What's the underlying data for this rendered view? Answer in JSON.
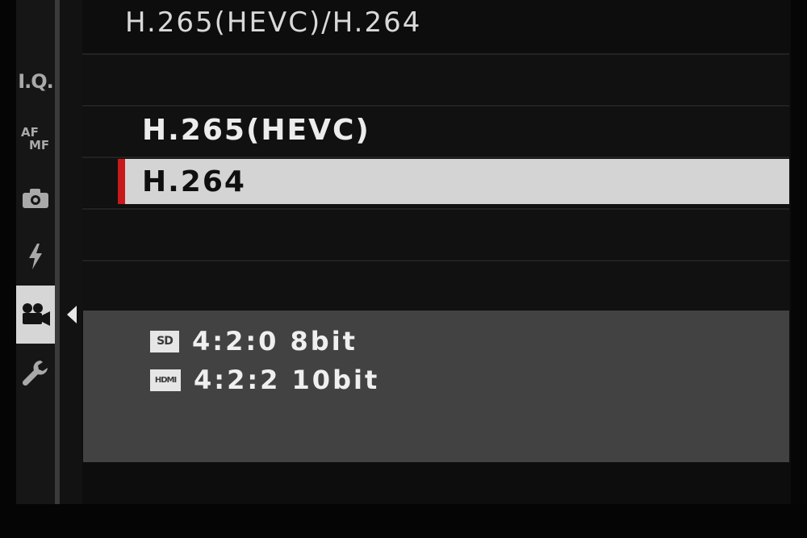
{
  "menu": {
    "title": "H.265(HEVC)/H.264",
    "options": [
      "H.265(HEVC)",
      "H.264"
    ],
    "selected_option": "H.264"
  },
  "sidebar": {
    "items": [
      {
        "icon": "iq-icon",
        "text": "I.Q."
      },
      {
        "icon": "af-mf-icon",
        "text_top": "AF",
        "text_bottom": "MF"
      },
      {
        "icon": "camera-icon"
      },
      {
        "icon": "flash-icon"
      },
      {
        "icon": "movie-camera-icon",
        "active": true
      },
      {
        "icon": "wrench-icon"
      }
    ]
  },
  "info": {
    "lines": [
      {
        "badge": "SD",
        "text": "4:2:0 8bit"
      },
      {
        "badge": "HDMI",
        "text": "4:2:2 10bit"
      }
    ]
  },
  "colors": {
    "selection_marker": "#c81a1a",
    "selected_row": "#d4d4d4",
    "info_panel": "#424242"
  }
}
